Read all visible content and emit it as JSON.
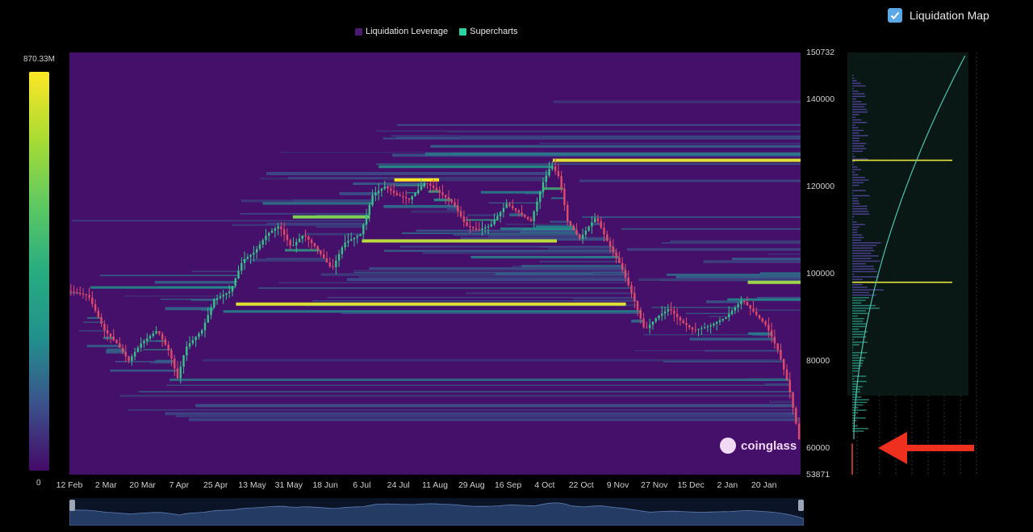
{
  "legend": {
    "items": [
      {
        "label": "Liquidation Leverage",
        "color": "#4a1a6e"
      },
      {
        "label": "Supercharts",
        "color": "#2bd4a1"
      }
    ]
  },
  "toggle": {
    "label": "Liquidation Map",
    "checked": true
  },
  "colorbar": {
    "max_label": "870.33M",
    "min_label": "0",
    "colormap": "viridis"
  },
  "watermark": {
    "text": "coinglass"
  },
  "chart_data": {
    "type": "heatmap",
    "title": "",
    "y_ticks": [
      "150732",
      "140000",
      "120000",
      "100000",
      "80000",
      "60000",
      "53871"
    ],
    "y_tick_values": [
      150732,
      140000,
      120000,
      100000,
      80000,
      60000,
      53871
    ],
    "ylim": [
      53871,
      150732
    ],
    "x_ticks": [
      "12 Feb",
      "2 Mar",
      "20 Mar",
      "7 Apr",
      "25 Apr",
      "13 May",
      "31 May",
      "18 Jun",
      "6 Jul",
      "24 Jul",
      "11 Aug",
      "29 Aug",
      "16 Sep",
      "4 Oct",
      "22 Oct",
      "9 Nov",
      "27 Nov",
      "15 Dec",
      "2 Jan",
      "20 Jan"
    ],
    "x_days": [
      0,
      18,
      36,
      54,
      72,
      90,
      108,
      126,
      144,
      162,
      180,
      198,
      216,
      234,
      252,
      270,
      288,
      306,
      324,
      342
    ],
    "x_range_days": [
      0,
      360
    ],
    "price_path": [
      {
        "d": 0,
        "p": 96000
      },
      {
        "d": 10,
        "p": 95000
      },
      {
        "d": 18,
        "p": 87000
      },
      {
        "d": 24,
        "p": 84000
      },
      {
        "d": 30,
        "p": 80000
      },
      {
        "d": 36,
        "p": 84000
      },
      {
        "d": 44,
        "p": 87000
      },
      {
        "d": 50,
        "p": 82000
      },
      {
        "d": 54,
        "p": 76000
      },
      {
        "d": 58,
        "p": 83000
      },
      {
        "d": 66,
        "p": 87000
      },
      {
        "d": 72,
        "p": 94000
      },
      {
        "d": 80,
        "p": 96000
      },
      {
        "d": 86,
        "p": 103000
      },
      {
        "d": 92,
        "p": 105000
      },
      {
        "d": 98,
        "p": 109000
      },
      {
        "d": 104,
        "p": 111000
      },
      {
        "d": 110,
        "p": 106000
      },
      {
        "d": 116,
        "p": 109000
      },
      {
        "d": 122,
        "p": 106000
      },
      {
        "d": 130,
        "p": 101000
      },
      {
        "d": 136,
        "p": 107000
      },
      {
        "d": 144,
        "p": 109000
      },
      {
        "d": 150,
        "p": 118000
      },
      {
        "d": 156,
        "p": 120000
      },
      {
        "d": 162,
        "p": 118000
      },
      {
        "d": 168,
        "p": 117000
      },
      {
        "d": 176,
        "p": 121000
      },
      {
        "d": 182,
        "p": 119000
      },
      {
        "d": 190,
        "p": 116000
      },
      {
        "d": 196,
        "p": 111000
      },
      {
        "d": 202,
        "p": 110000
      },
      {
        "d": 208,
        "p": 111000
      },
      {
        "d": 216,
        "p": 116000
      },
      {
        "d": 222,
        "p": 114000
      },
      {
        "d": 228,
        "p": 112000
      },
      {
        "d": 234,
        "p": 121000
      },
      {
        "d": 238,
        "p": 125000
      },
      {
        "d": 242,
        "p": 122000
      },
      {
        "d": 246,
        "p": 112000
      },
      {
        "d": 252,
        "p": 108000
      },
      {
        "d": 260,
        "p": 113000
      },
      {
        "d": 266,
        "p": 107000
      },
      {
        "d": 272,
        "p": 102000
      },
      {
        "d": 278,
        "p": 95000
      },
      {
        "d": 284,
        "p": 87000
      },
      {
        "d": 290,
        "p": 90000
      },
      {
        "d": 296,
        "p": 92000
      },
      {
        "d": 302,
        "p": 89000
      },
      {
        "d": 308,
        "p": 87000
      },
      {
        "d": 316,
        "p": 88000
      },
      {
        "d": 324,
        "p": 90000
      },
      {
        "d": 332,
        "p": 94000
      },
      {
        "d": 338,
        "p": 91000
      },
      {
        "d": 344,
        "p": 88000
      },
      {
        "d": 350,
        "p": 82000
      },
      {
        "d": 355,
        "p": 74000
      },
      {
        "d": 360,
        "p": 62000
      }
    ],
    "bright_levels": [
      {
        "price": 126000,
        "from_day": 238,
        "to_day": 360,
        "intensity": 0.95
      },
      {
        "price": 121500,
        "from_day": 160,
        "to_day": 182,
        "intensity": 1.0
      },
      {
        "price": 107500,
        "from_day": 144,
        "to_day": 240,
        "intensity": 0.9
      },
      {
        "price": 93000,
        "from_day": 82,
        "to_day": 274,
        "intensity": 0.95
      },
      {
        "price": 98000,
        "from_day": 334,
        "to_day": 360,
        "intensity": 0.85
      },
      {
        "price": 113000,
        "from_day": 110,
        "to_day": 148,
        "intensity": 0.8
      }
    ],
    "side_panel": {
      "type": "cumulative liquidation profile",
      "highlight_levels": [
        126000,
        98000
      ],
      "marker_price": 61000
    }
  }
}
